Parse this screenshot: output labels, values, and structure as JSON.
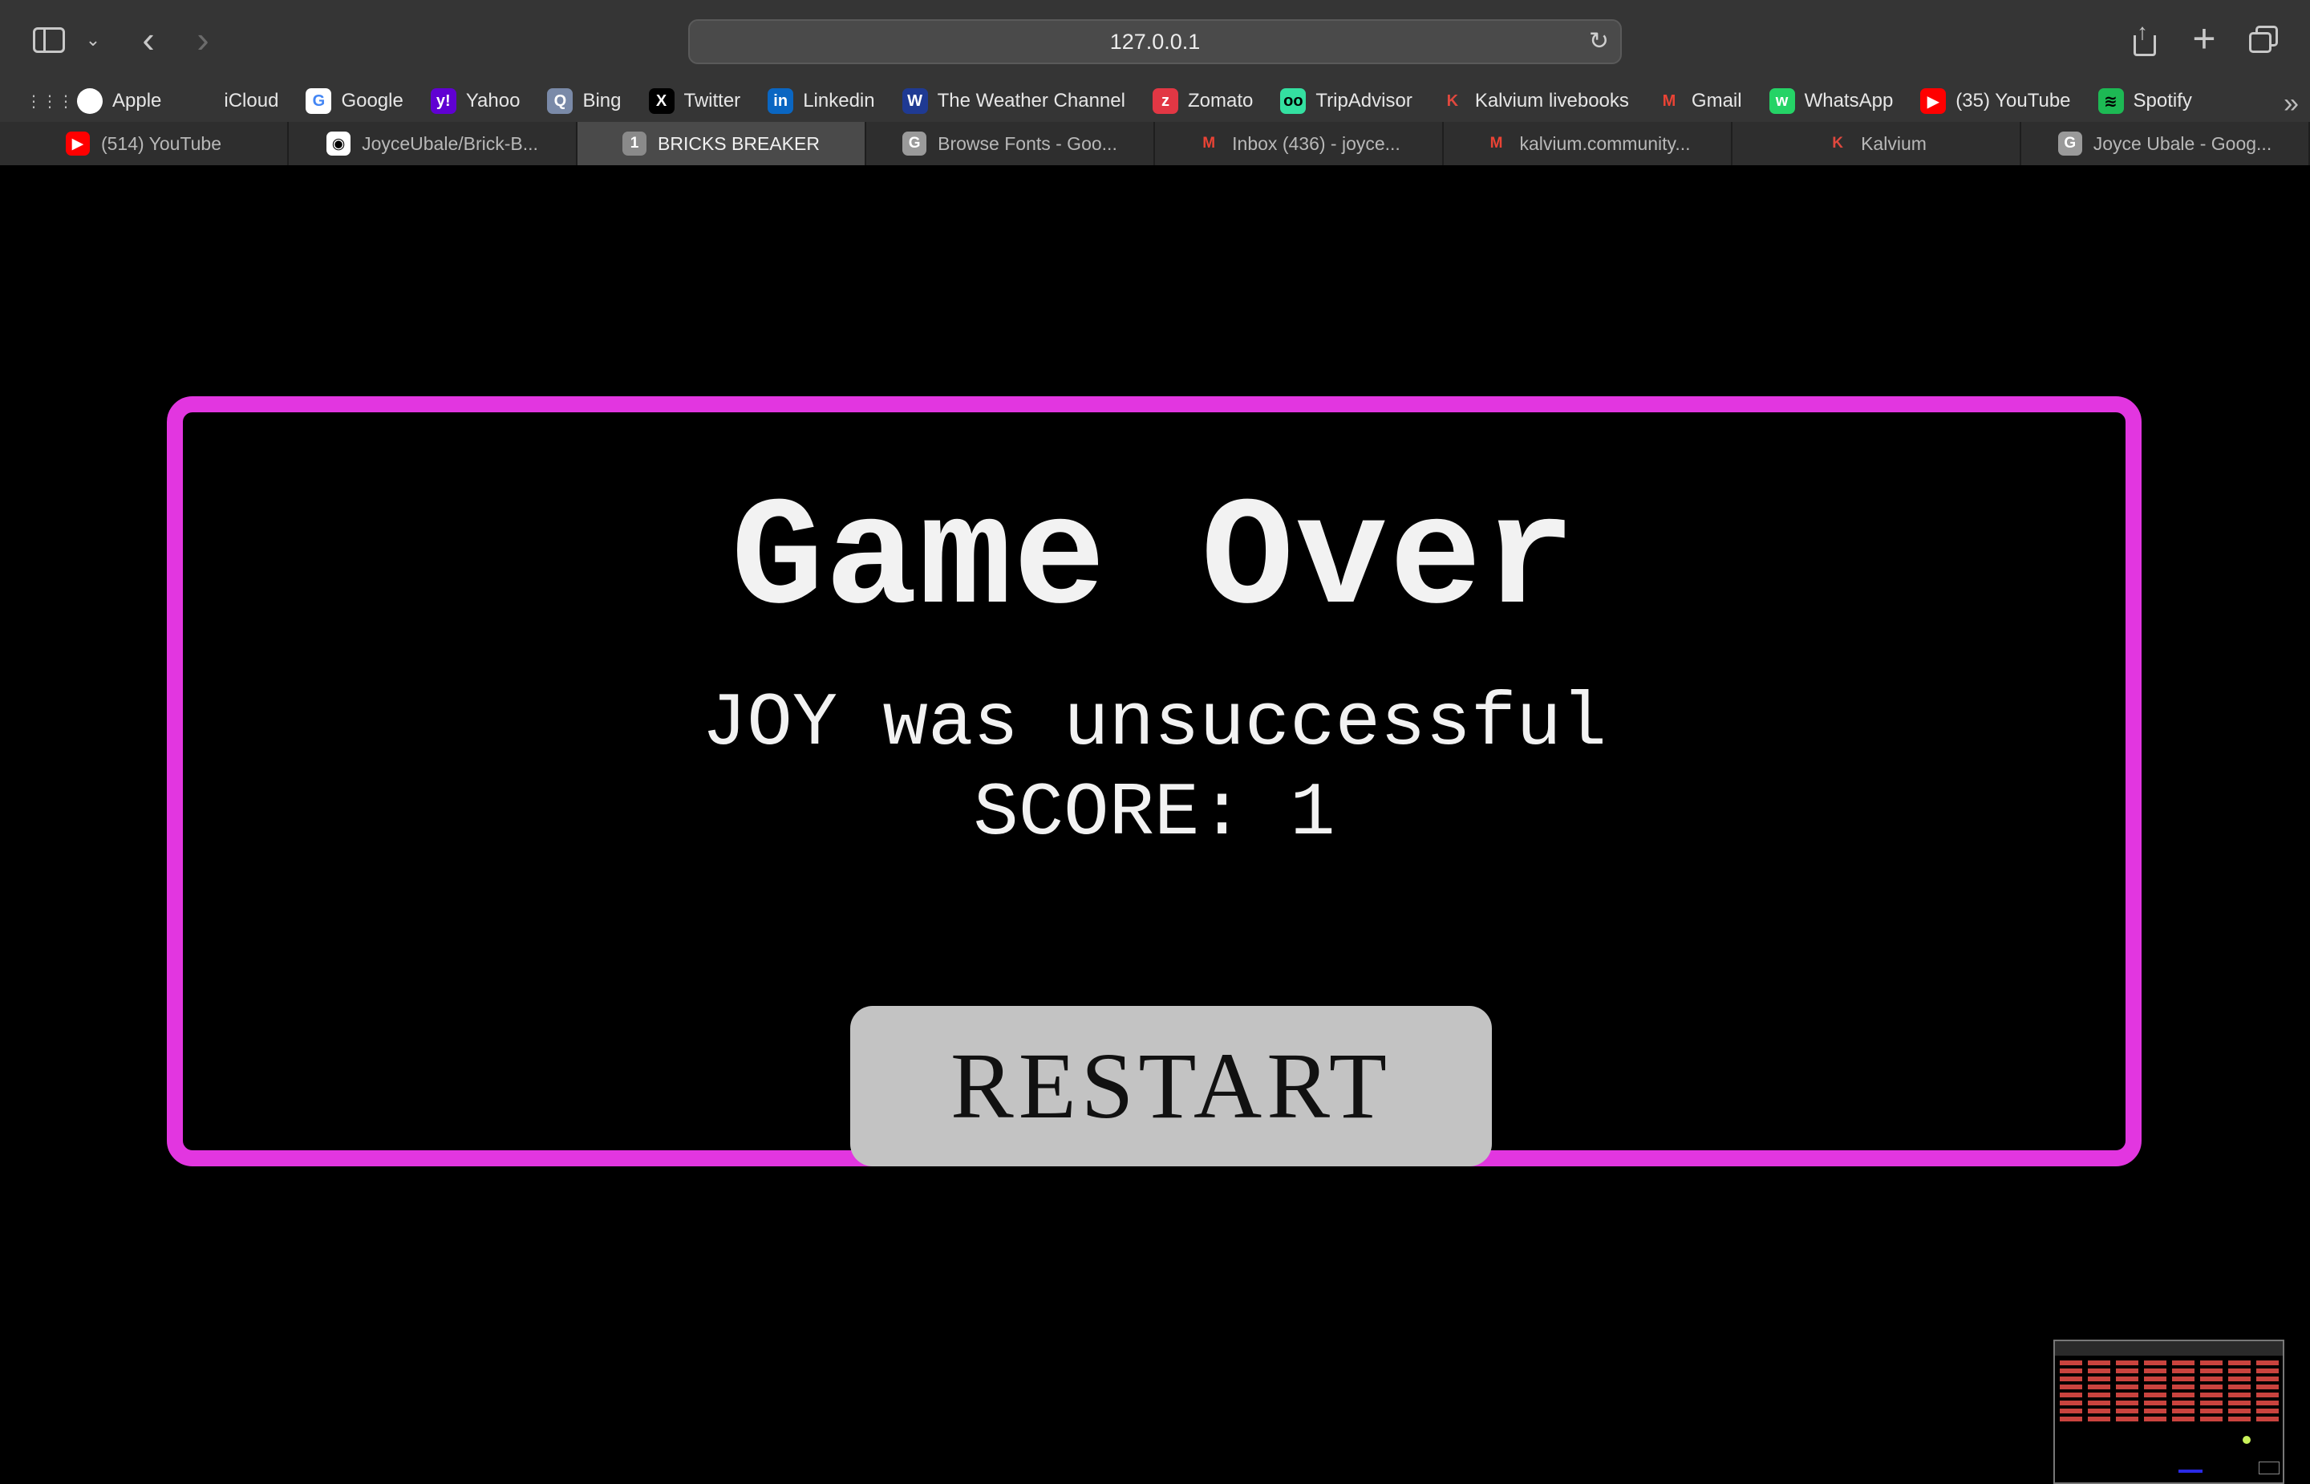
{
  "browser": {
    "address": "127.0.0.1",
    "bookmarks": [
      {
        "label": "Apple",
        "icon": "apple-icon",
        "bg": "#ffffff",
        "fg": "#000000",
        "glyph": ""
      },
      {
        "label": "iCloud",
        "icon": "icloud-icon",
        "bg": "transparent",
        "fg": "#cfcfcf",
        "glyph": ""
      },
      {
        "label": "Google",
        "icon": "google-icon",
        "bg": "#ffffff",
        "fg": "#4285f4",
        "glyph": "G"
      },
      {
        "label": "Yahoo",
        "icon": "yahoo-icon",
        "bg": "#6001d2",
        "fg": "#ffffff",
        "glyph": "y!"
      },
      {
        "label": "Bing",
        "icon": "bing-icon",
        "bg": "#7a8aa8",
        "fg": "#ffffff",
        "glyph": "Q"
      },
      {
        "label": "Twitter",
        "icon": "x-twitter-icon",
        "bg": "#000000",
        "fg": "#ffffff",
        "glyph": "X"
      },
      {
        "label": "Linkedin",
        "icon": "linkedin-icon",
        "bg": "#0a66c2",
        "fg": "#ffffff",
        "glyph": "in"
      },
      {
        "label": "The Weather Channel",
        "icon": "weather-channel-icon",
        "bg": "#1f3a93",
        "fg": "#ffffff",
        "glyph": "W"
      },
      {
        "label": "Zomato",
        "icon": "zomato-icon",
        "bg": "#e23744",
        "fg": "#ffffff",
        "glyph": "z"
      },
      {
        "label": "TripAdvisor",
        "icon": "tripadvisor-icon",
        "bg": "#34e0a1",
        "fg": "#000000",
        "glyph": "oo"
      },
      {
        "label": "Kalvium livebooks",
        "icon": "kalvium-icon",
        "bg": "transparent",
        "fg": "#e0483e",
        "glyph": "K"
      },
      {
        "label": "Gmail",
        "icon": "gmail-icon",
        "bg": "transparent",
        "fg": "#ea4335",
        "glyph": "M"
      },
      {
        "label": "WhatsApp",
        "icon": "whatsapp-icon",
        "bg": "#25d366",
        "fg": "#ffffff",
        "glyph": "w"
      },
      {
        "label": "(35) YouTube",
        "icon": "youtube-icon",
        "bg": "#ff0000",
        "fg": "#ffffff",
        "glyph": "▶"
      },
      {
        "label": "Spotify",
        "icon": "spotify-icon",
        "bg": "#1db954",
        "fg": "#000000",
        "glyph": "≋"
      }
    ],
    "tabs": [
      {
        "label": "(514) YouTube",
        "icon": "youtube-icon",
        "bg": "#ff0000",
        "fg": "#ffffff",
        "glyph": "▶",
        "active": false
      },
      {
        "label": "JoyceUbale/Brick-B...",
        "icon": "github-icon",
        "bg": "#ffffff",
        "fg": "#000000",
        "glyph": "◉",
        "active": false
      },
      {
        "label": "BRICKS BREAKER",
        "icon": "tab-number-icon",
        "bg": "#8a8a8a",
        "fg": "#ffffff",
        "glyph": "1",
        "active": true
      },
      {
        "label": "Browse Fonts - Goo...",
        "icon": "google-fonts-icon",
        "bg": "#9a9a9a",
        "fg": "#ffffff",
        "glyph": "G",
        "active": false
      },
      {
        "label": "Inbox (436) - joyce...",
        "icon": "gmail-icon",
        "bg": "transparent",
        "fg": "#ea4335",
        "glyph": "M",
        "active": false
      },
      {
        "label": "kalvium.community...",
        "icon": "gmail-icon",
        "bg": "transparent",
        "fg": "#ea4335",
        "glyph": "M",
        "active": false
      },
      {
        "label": "Kalvium",
        "icon": "kalvium-icon",
        "bg": "transparent",
        "fg": "#e0483e",
        "glyph": "K",
        "active": false
      },
      {
        "label": "Joyce Ubale - Goog...",
        "icon": "google-docs-icon",
        "bg": "#9a9a9a",
        "fg": "#ffffff",
        "glyph": "G",
        "active": false
      }
    ]
  },
  "game": {
    "title": "Game Over",
    "message": "JOY was unsuccessful",
    "score_text": "SCORE: 1",
    "restart_label": "RESTART",
    "border_color": "#e236e0",
    "button_color": "#c3c3c3"
  }
}
